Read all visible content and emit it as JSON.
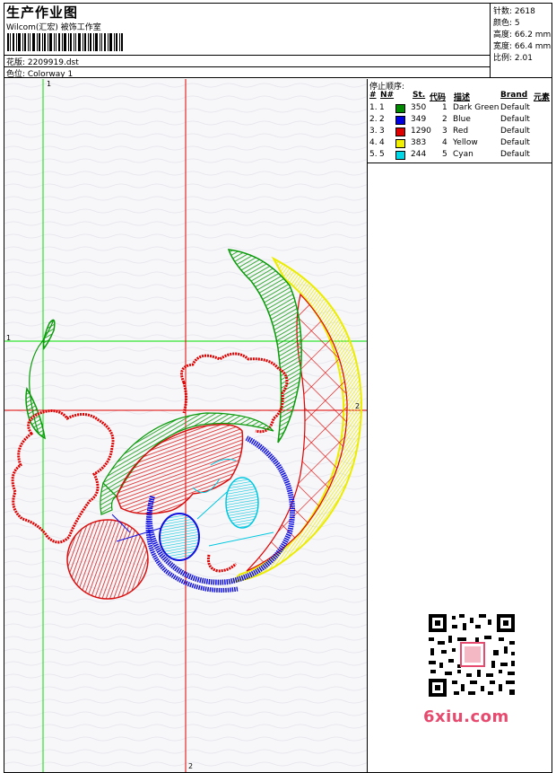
{
  "header": {
    "title": "生产作业图",
    "subtitle": "Wilcom(汇宏) 被饰工作室",
    "design_label": "花版: 2209919.dst",
    "colorway_label": "色位: Colorway 1"
  },
  "stats": {
    "stitches": "针数: 2618",
    "colors": "颜色: 5",
    "height": "高度: 66.2 mm",
    "width": "宽度: 66.4 mm",
    "scale": "比例: 2.01"
  },
  "stop_sequence": {
    "heading": "停止顺序:",
    "columns": [
      "#",
      "N#",
      "St.",
      "代码",
      "描述",
      "Brand",
      "元素"
    ],
    "rows": [
      {
        "num": "1.",
        "n": "1",
        "color": "#008a00",
        "st": "350",
        "code": "1",
        "desc": "Dark Green",
        "brand": "Default"
      },
      {
        "num": "2.",
        "n": "2",
        "color": "#0000e0",
        "st": "349",
        "code": "2",
        "desc": "Blue",
        "brand": "Default"
      },
      {
        "num": "3.",
        "n": "3",
        "color": "#e00000",
        "st": "1290",
        "code": "3",
        "desc": "Red",
        "brand": "Default"
      },
      {
        "num": "4.",
        "n": "4",
        "color": "#f0f000",
        "st": "383",
        "code": "4",
        "desc": "Yellow",
        "brand": "Default"
      },
      {
        "num": "5.",
        "n": "5",
        "color": "#00d8e8",
        "st": "244",
        "code": "5",
        "desc": "Cyan",
        "brand": "Default"
      }
    ]
  },
  "axes": {
    "top_label": "1",
    "left_label": "1",
    "right_label": "2",
    "bottom_label": "2"
  },
  "watermark": {
    "brand_text": "6xiu.com",
    "qr_icon": "qr-code-icon"
  }
}
